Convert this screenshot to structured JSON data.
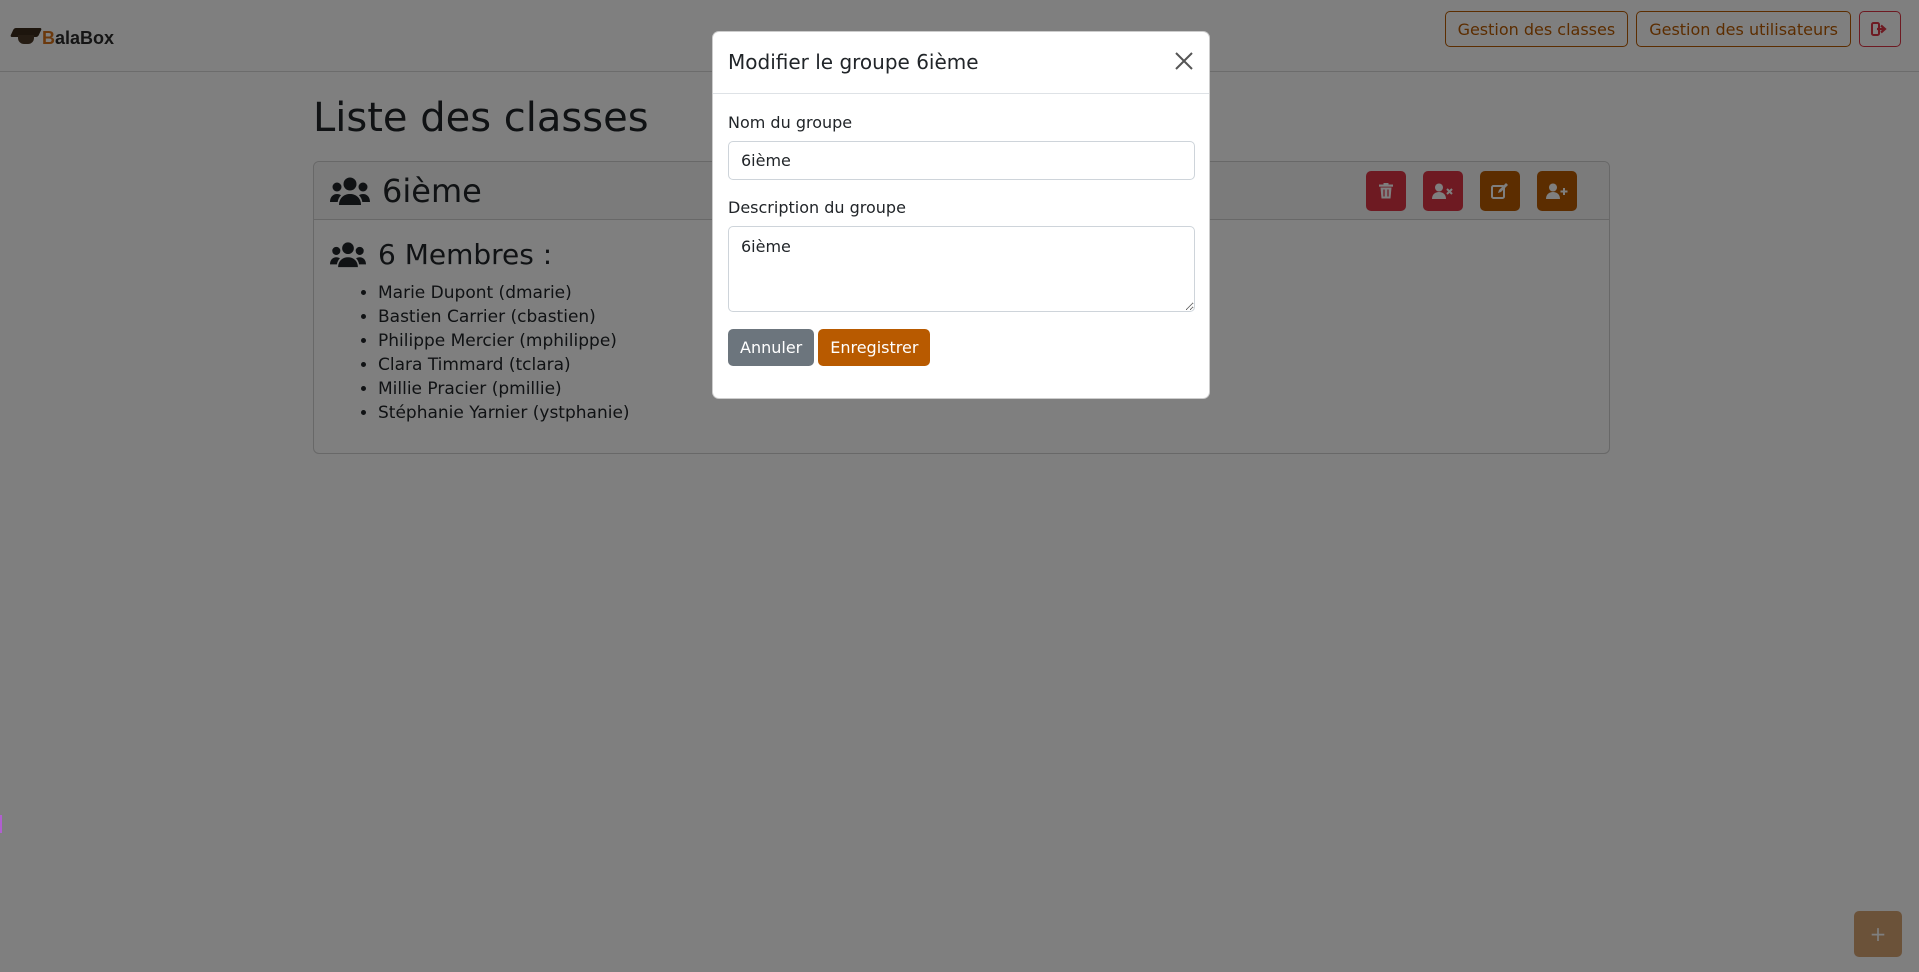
{
  "app": {
    "brand_prefix": "B",
    "brand_rest": "alaBox"
  },
  "navbar": {
    "classes_label": "Gestion des classes",
    "users_label": "Gestion des utilisateurs",
    "logout_icon": "sign-out-icon"
  },
  "page": {
    "title": "Liste des classes"
  },
  "group": {
    "name": "6ième",
    "members_title": "6 Membres :",
    "actions": [
      {
        "name": "delete-group-button",
        "icon": "trash-icon",
        "color": "#dc3545"
      },
      {
        "name": "remove-member-button",
        "icon": "user-times-icon",
        "color": "#dc3545"
      },
      {
        "name": "edit-group-button",
        "icon": "edit-icon",
        "color": "#b85a00"
      },
      {
        "name": "add-member-button",
        "icon": "user-plus-icon",
        "color": "#b85a00"
      }
    ],
    "members": [
      "Marie Dupont (dmarie)",
      "Bastien Carrier (cbastien)",
      "Philippe Mercier (mphilippe)",
      "Clara Timmard (tclara)",
      "Millie Pracier (pmillie)",
      "Stéphanie Yarnier (ystphanie)"
    ]
  },
  "fab": {
    "label": "+"
  },
  "modal": {
    "title": "Modifier le groupe 6ième",
    "name_label": "Nom du groupe",
    "name_value": "6ième",
    "description_label": "Description du groupe",
    "description_value": "6ième",
    "cancel_label": "Annuler",
    "save_label": "Enregistrer"
  },
  "colors": {
    "accent": "#b85a00",
    "danger": "#dc3545",
    "secondary": "#6c757d"
  }
}
